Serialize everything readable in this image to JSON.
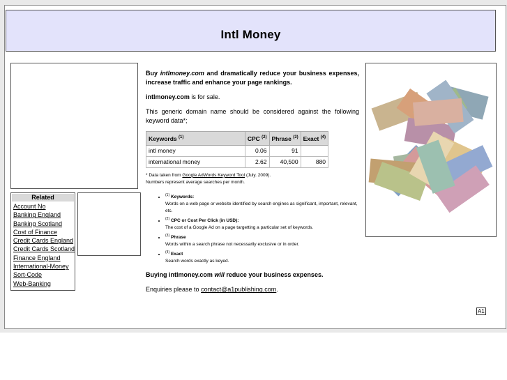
{
  "header": {
    "title": "Intl Money"
  },
  "related": {
    "title": "Related",
    "links": [
      "Account No",
      "Banking England",
      "Banking Scotland",
      "Cost of Finance",
      "Credit Cards England",
      "Credit Cards Scotland",
      "Finance England",
      "International-Money",
      "Sort-Code",
      "Web-Banking"
    ]
  },
  "intro": {
    "buy": "Buy",
    "domain_italic": "intlmoney.com",
    "rest": "and dramatically reduce your business expenses, increase traffic and enhance your page rankings."
  },
  "sale": {
    "domain": "intlmoney.com",
    "text": "is for sale."
  },
  "generic_text": "This generic domain name should be considered against the following keyword data*;",
  "table": {
    "headers": [
      "Keywords",
      "CPC",
      "Phrase",
      "Exact"
    ],
    "header_refs": [
      "(1)",
      "(2)",
      "(3)",
      "(4)"
    ],
    "rows": [
      [
        "intl money",
        "0.06",
        "91",
        ""
      ],
      [
        "international money",
        "2.62",
        "40,500",
        "880"
      ]
    ]
  },
  "note": {
    "prefix": "* Data taken from",
    "link": "Google AdWords Keyword Tool",
    "suffix": "(July. 2009).",
    "line2": "Numbers represent average searches per month."
  },
  "definitions": [
    {
      "ref": "(1)",
      "term": "Keywords:",
      "desc": "Words on a web page or website identified by search engines as significant, important, relevant, etc."
    },
    {
      "ref": "(2)",
      "term": "CPC or Cost Per Click (in USD):",
      "desc": "The cost of a Google Ad on a page targetting a particular set of keywords."
    },
    {
      "ref": "(3)",
      "term": "Phrase",
      "desc": "Words within a search phrase not necessarily exclusive or in order."
    },
    {
      "ref": "(4)",
      "term": "Exact",
      "desc": "Search words exactly as keyed."
    }
  ],
  "buying": {
    "prefix": "Buying intlmoney.com",
    "will": "will",
    "suffix": "reduce your business expenses."
  },
  "enquiries": {
    "text": "Enquiries please to",
    "email": "contact@a1publishing.com",
    "end": "."
  },
  "badge": "A1",
  "icons": {
    "money_image": "banknotes-image"
  }
}
